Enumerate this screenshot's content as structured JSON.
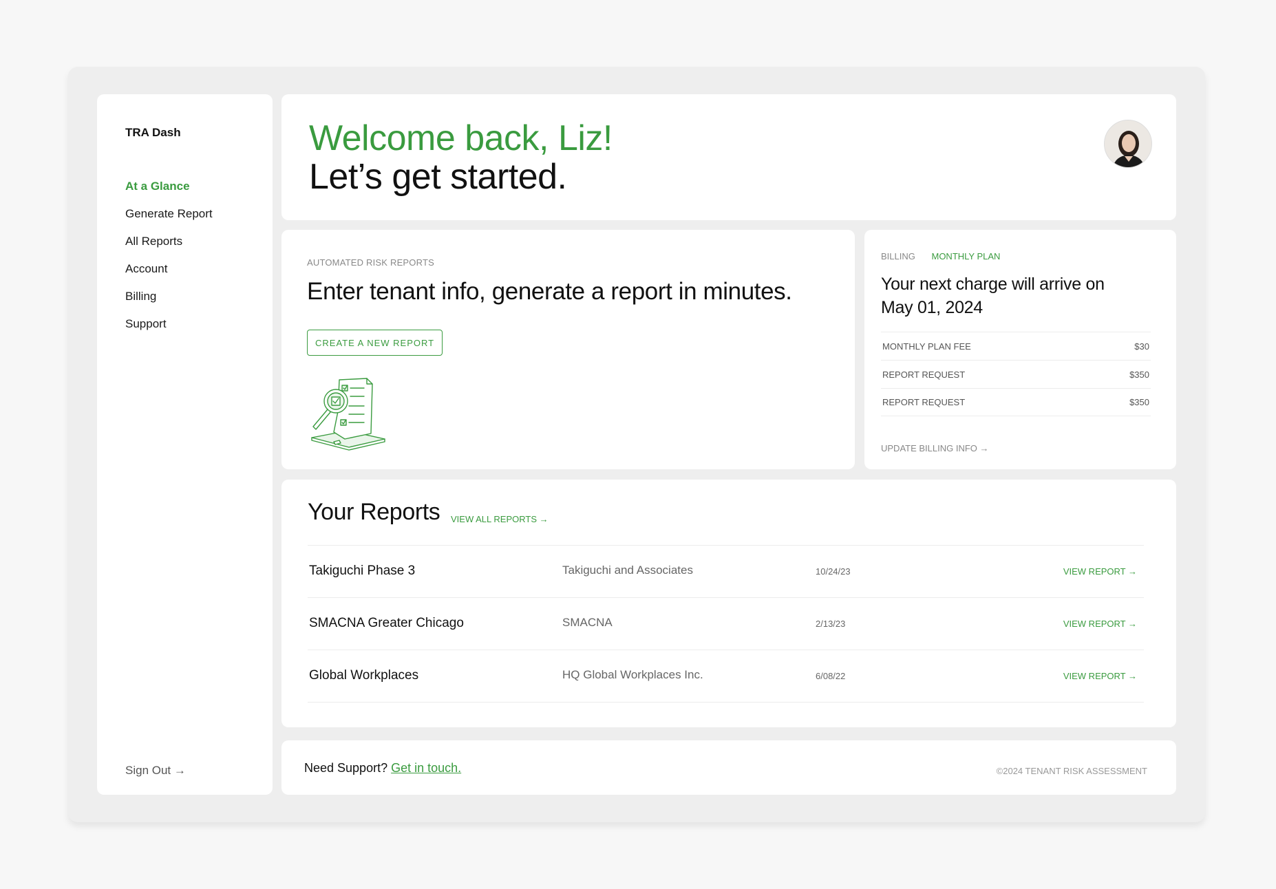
{
  "sidebar": {
    "brand": "TRA Dash",
    "items": [
      {
        "label": "At a Glance",
        "active": true
      },
      {
        "label": "Generate Report",
        "active": false
      },
      {
        "label": "All Reports",
        "active": false
      },
      {
        "label": "Account",
        "active": false
      },
      {
        "label": "Billing",
        "active": false
      },
      {
        "label": "Support",
        "active": false
      }
    ],
    "sign_out": "Sign Out →"
  },
  "welcome": {
    "line1": "Welcome back, Liz!",
    "line2": "Let’s get started."
  },
  "promo": {
    "eyebrow": "AUTOMATED RISK REPORTS",
    "title": "Enter tenant info, generate a report in minutes.",
    "button": "CREATE A NEW REPORT"
  },
  "billing": {
    "tab_billing": "BILLING",
    "tab_plan": "MONTHLY PLAN",
    "message": "Your next charge will arrive on May 01, 2024",
    "fees": [
      {
        "label": "MONTHLY PLAN FEE",
        "amount": "$30"
      },
      {
        "label": "REPORT REQUEST",
        "amount": "$350"
      },
      {
        "label": "REPORT REQUEST",
        "amount": "$350"
      }
    ],
    "update_link": "UPDATE BILLING INFO →"
  },
  "reports": {
    "title": "Your Reports",
    "view_all": "VIEW ALL REPORTS →",
    "rows": [
      {
        "name": "Takiguchi Phase 3",
        "client": "Takiguchi and Associates",
        "date": "10/24/23",
        "action": "VIEW REPORT →"
      },
      {
        "name": "SMACNA Greater Chicago",
        "client": "SMACNA",
        "date": "2/13/23",
        "action": "VIEW REPORT →"
      },
      {
        "name": "Global Workplaces",
        "client": "HQ Global Workplaces Inc.",
        "date": "6/08/22",
        "action": "VIEW REPORT →"
      }
    ]
  },
  "footer": {
    "support_text": "Need Support?",
    "support_link": "Get in touch.",
    "copyright": "©2024 TENANT RISK ASSESSMENT"
  },
  "colors": {
    "accent": "#3a9b3f",
    "background": "#f7f7f7",
    "frame": "#eeeeee",
    "card": "#ffffff"
  }
}
